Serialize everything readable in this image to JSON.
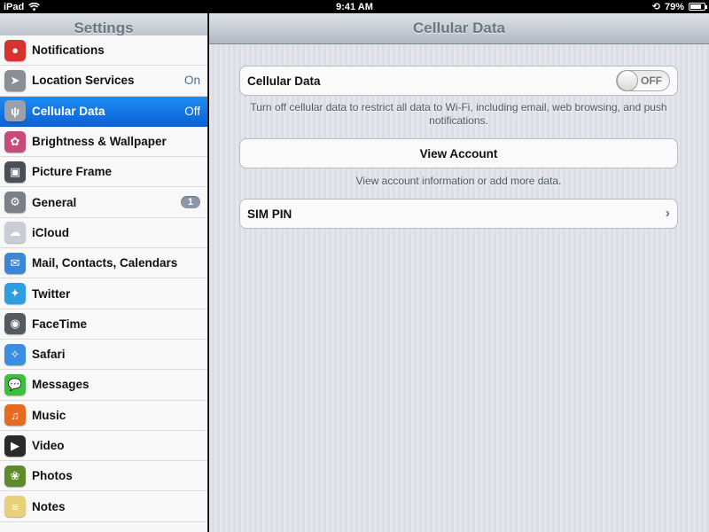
{
  "statusbar": {
    "device": "iPad",
    "time": "9:41 AM",
    "battery": "79%",
    "battery_level": 0.79
  },
  "sidebar": {
    "title": "Settings",
    "items": [
      {
        "name": "notifications",
        "label": "Notifications",
        "value": "",
        "icon": "notifications-icon",
        "color": "#d8322d",
        "glyph": "●"
      },
      {
        "name": "location-services",
        "label": "Location Services",
        "value": "On",
        "icon": "location-arrow-icon",
        "color": "#8a8f96",
        "glyph": "➤"
      },
      {
        "name": "cellular-data",
        "label": "Cellular Data",
        "value": "Off",
        "icon": "cellular-antenna-icon",
        "color": "#9aa1ab",
        "glyph": "ψ",
        "selected": true
      },
      {
        "name": "brightness-wallpaper",
        "label": "Brightness & Wallpaper",
        "value": "",
        "icon": "flower-wallpaper-icon",
        "color": "#c84a7a",
        "glyph": "✿"
      },
      {
        "name": "picture-frame",
        "label": "Picture Frame",
        "value": "",
        "icon": "picture-frame-icon",
        "color": "#4a4f57",
        "glyph": "▣"
      },
      {
        "name": "general",
        "label": "General",
        "value": "",
        "badge": "1",
        "icon": "gear-icon",
        "color": "#7b8088",
        "glyph": "⚙"
      },
      {
        "name": "icloud",
        "label": "iCloud",
        "value": "",
        "icon": "cloud-icon",
        "color": "#c9ced6",
        "glyph": "☁"
      },
      {
        "name": "mail-contacts-calendars",
        "label": "Mail, Contacts, Calendars",
        "value": "",
        "icon": "mail-envelope-icon",
        "color": "#3c86d8",
        "glyph": "✉"
      },
      {
        "name": "twitter",
        "label": "Twitter",
        "value": "",
        "icon": "twitter-bird-icon",
        "color": "#2f9ee0",
        "glyph": "✦"
      },
      {
        "name": "facetime",
        "label": "FaceTime",
        "value": "",
        "icon": "facetime-camera-icon",
        "color": "#555a61",
        "glyph": "◉"
      },
      {
        "name": "safari",
        "label": "Safari",
        "value": "",
        "icon": "safari-compass-icon",
        "color": "#3a8fe0",
        "glyph": "✧"
      },
      {
        "name": "messages",
        "label": "Messages",
        "value": "",
        "icon": "messages-bubble-icon",
        "color": "#3cbf3c",
        "glyph": "💬"
      },
      {
        "name": "music",
        "label": "Music",
        "value": "",
        "icon": "music-note-icon",
        "color": "#e86a20",
        "glyph": "♫"
      },
      {
        "name": "video",
        "label": "Video",
        "value": "",
        "icon": "video-clapper-icon",
        "color": "#2a2a2a",
        "glyph": "▶"
      },
      {
        "name": "photos",
        "label": "Photos",
        "value": "",
        "icon": "photos-sunflower-icon",
        "color": "#5f8a2c",
        "glyph": "❀"
      },
      {
        "name": "notes",
        "label": "Notes",
        "value": "",
        "icon": "notes-pad-icon",
        "color": "#e8d07a",
        "glyph": "≡"
      }
    ]
  },
  "detail": {
    "title": "Cellular Data",
    "cellular_label": "Cellular Data",
    "toggle_state": "OFF",
    "cellular_footer": "Turn off cellular data to restrict all data to Wi-Fi, including email, web browsing, and push notifications.",
    "view_account_label": "View Account",
    "view_account_footer": "View account information or add more data.",
    "sim_pin_label": "SIM PIN"
  }
}
